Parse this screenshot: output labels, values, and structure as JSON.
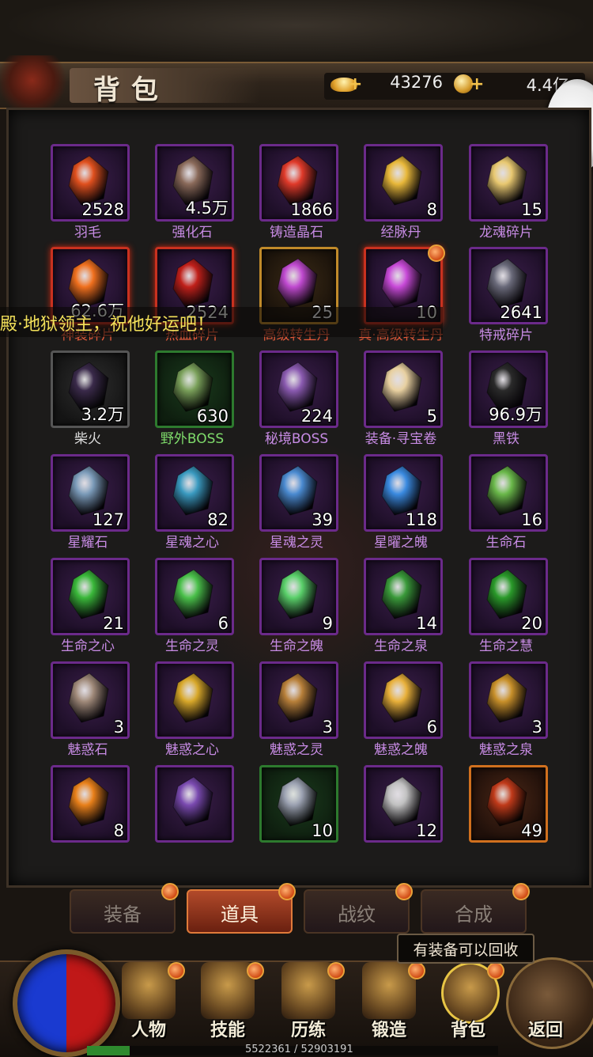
{
  "header": {
    "title": "背包",
    "gold": "43276",
    "diamond": "4.4亿"
  },
  "broadcast": "殿·地狱领主，祝他好运吧！",
  "items": [
    {
      "name": "羽毛",
      "qty": "2528",
      "frame": "purple",
      "nameColor": "purple",
      "icon": "feather-icon",
      "dot": false
    },
    {
      "name": "强化石",
      "qty": "4.5万",
      "frame": "purple",
      "nameColor": "purple",
      "icon": "enhance-stone-icon",
      "dot": false
    },
    {
      "name": "铸造晶石",
      "qty": "1866",
      "frame": "purple",
      "nameColor": "purple",
      "icon": "crystal-icon",
      "dot": false
    },
    {
      "name": "经脉丹",
      "qty": "8",
      "frame": "purple",
      "nameColor": "purple",
      "icon": "pill-icon",
      "dot": false
    },
    {
      "name": "龙魂碎片",
      "qty": "15",
      "frame": "purple",
      "nameColor": "purple",
      "icon": "dragon-soul-icon",
      "dot": false
    },
    {
      "name": "神装碎片",
      "qty": "62.6万",
      "frame": "red",
      "nameColor": "red",
      "icon": "divine-shard-icon",
      "dot": false
    },
    {
      "name": "热血碎片",
      "qty": "2524",
      "frame": "red",
      "nameColor": "red",
      "icon": "blood-shard-icon",
      "dot": false
    },
    {
      "name": "高级转生丹",
      "qty": "25",
      "frame": "gold",
      "nameColor": "red",
      "icon": "rebirth-orb-icon",
      "dot": false
    },
    {
      "name": "真·高级转生丹",
      "qty": "10",
      "frame": "red",
      "nameColor": "red",
      "icon": "true-rebirth-orb-icon",
      "dot": true
    },
    {
      "name": "特戒碎片",
      "qty": "2641",
      "frame": "purple",
      "nameColor": "purple",
      "icon": "ring-shard-icon",
      "dot": false
    },
    {
      "name": "柴火",
      "qty": "3.2万",
      "frame": "gray",
      "nameColor": "gray",
      "icon": "firewood-icon",
      "dot": false
    },
    {
      "name": "野外BOSS",
      "qty": "630",
      "frame": "green",
      "nameColor": "green",
      "icon": "field-scroll-icon",
      "dot": false
    },
    {
      "name": "秘境BOSS",
      "qty": "224",
      "frame": "purple",
      "nameColor": "purple",
      "icon": "secret-scroll-icon",
      "dot": false
    },
    {
      "name": "装备·寻宝卷",
      "qty": "5",
      "frame": "purple",
      "nameColor": "purple",
      "icon": "treasure-scroll-icon",
      "dot": false
    },
    {
      "name": "黑铁",
      "qty": "96.9万",
      "frame": "purple",
      "nameColor": "purple",
      "icon": "black-iron-icon",
      "dot": false
    },
    {
      "name": "星耀石",
      "qty": "127",
      "frame": "purple",
      "nameColor": "purple",
      "icon": "star-stone-icon",
      "dot": false
    },
    {
      "name": "星魂之心",
      "qty": "82",
      "frame": "purple",
      "nameColor": "purple",
      "icon": "star-heart-icon",
      "dot": false
    },
    {
      "name": "星魂之灵",
      "qty": "39",
      "frame": "purple",
      "nameColor": "purple",
      "icon": "star-spirit-icon",
      "dot": false
    },
    {
      "name": "星曜之魄",
      "qty": "118",
      "frame": "purple",
      "nameColor": "purple",
      "icon": "star-soul-flame-icon",
      "dot": false
    },
    {
      "name": "生命石",
      "qty": "16",
      "frame": "purple",
      "nameColor": "purple",
      "icon": "life-stone-icon",
      "dot": false
    },
    {
      "name": "生命之心",
      "qty": "21",
      "frame": "purple",
      "nameColor": "purple",
      "icon": "life-heart-icon",
      "dot": false
    },
    {
      "name": "生命之灵",
      "qty": "6",
      "frame": "purple",
      "nameColor": "purple",
      "icon": "life-spirit-icon",
      "dot": false
    },
    {
      "name": "生命之魄",
      "qty": "9",
      "frame": "purple",
      "nameColor": "purple",
      "icon": "life-flame-icon",
      "dot": false
    },
    {
      "name": "生命之泉",
      "qty": "14",
      "frame": "purple",
      "nameColor": "purple",
      "icon": "life-spring-icon",
      "dot": false
    },
    {
      "name": "生命之慧",
      "qty": "20",
      "frame": "purple",
      "nameColor": "purple",
      "icon": "life-eye-icon",
      "dot": false
    },
    {
      "name": "魅惑石",
      "qty": "3",
      "frame": "purple",
      "nameColor": "purple",
      "icon": "charm-stone-icon",
      "dot": false
    },
    {
      "name": "魅惑之心",
      "qty": "",
      "frame": "purple",
      "nameColor": "purple",
      "icon": "charm-heart-icon",
      "dot": false
    },
    {
      "name": "魅惑之灵",
      "qty": "3",
      "frame": "purple",
      "nameColor": "purple",
      "icon": "charm-spirit-icon",
      "dot": false
    },
    {
      "name": "魅惑之魄",
      "qty": "6",
      "frame": "purple",
      "nameColor": "purple",
      "icon": "charm-flame-icon",
      "dot": false
    },
    {
      "name": "魅惑之泉",
      "qty": "3",
      "frame": "purple",
      "nameColor": "purple",
      "icon": "charm-spring-icon",
      "dot": false
    },
    {
      "name": "",
      "qty": "8",
      "frame": "purple",
      "nameColor": "purple",
      "icon": "fire-eye-icon",
      "dot": false
    },
    {
      "name": "",
      "qty": "",
      "frame": "purple",
      "nameColor": "purple",
      "icon": "purple-stone-icon",
      "dot": false
    },
    {
      "name": "",
      "qty": "10",
      "frame": "green",
      "nameColor": "green",
      "icon": "rune-stone-blue-icon",
      "dot": false
    },
    {
      "name": "",
      "qty": "12",
      "frame": "purple",
      "nameColor": "purple",
      "icon": "rune-stone-red-icon",
      "dot": false
    },
    {
      "name": "",
      "qty": "49",
      "frame": "orange",
      "nameColor": "purple",
      "icon": "skill-book-icon",
      "dot": false
    }
  ],
  "tabs": [
    {
      "label": "装备",
      "active": false
    },
    {
      "label": "道具",
      "active": true
    },
    {
      "label": "战纹",
      "active": false
    },
    {
      "label": "合成",
      "active": false
    }
  ],
  "recycle_tip": "有装备可以回收",
  "nav": [
    {
      "label": "人物",
      "icon": "helmet-icon"
    },
    {
      "label": "技能",
      "icon": "book-icon"
    },
    {
      "label": "历练",
      "icon": "swords-icon"
    },
    {
      "label": "锻造",
      "icon": "anvil-icon"
    },
    {
      "label": "背包",
      "icon": "bag-icon"
    },
    {
      "label": "返回",
      "icon": "return-icon"
    }
  ],
  "exp": {
    "text": "5522361 / 52903191",
    "fraction": 0.104
  },
  "colors": {
    "purple": "#6b2a8a",
    "red": "#c8311f",
    "gold": "#c08a2a",
    "green": "#2d7a2e",
    "accent": "#e8a23a"
  }
}
